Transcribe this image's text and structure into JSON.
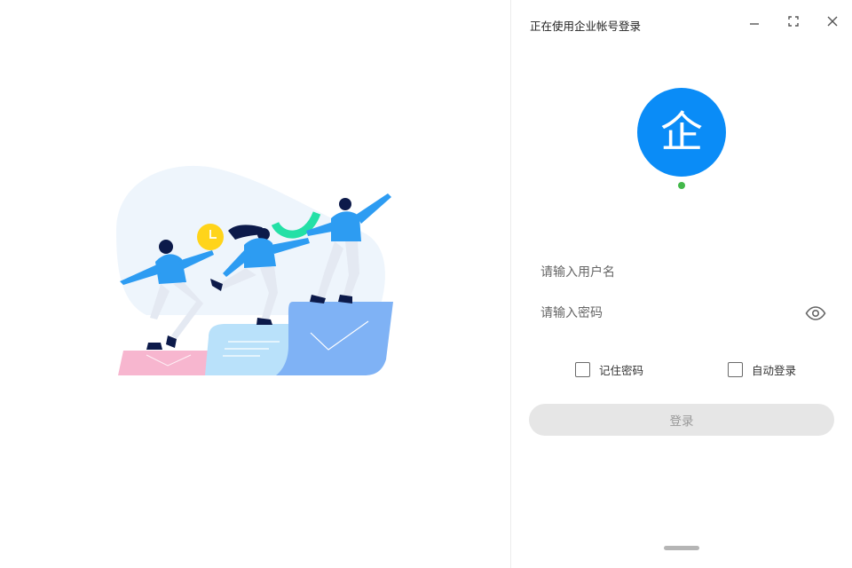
{
  "window": {
    "title": "正在使用企业帐号登录",
    "controls": {
      "minimize_icon": "minimize-icon",
      "maximize_icon": "maximize-icon",
      "close_icon": "close-icon"
    }
  },
  "illustration": {
    "icon": "team-running-illustration"
  },
  "avatar": {
    "char": "企",
    "bg_color": "#0a8cf7",
    "status": "online",
    "status_color": "#43b84a"
  },
  "form": {
    "username": {
      "value": "",
      "placeholder": "请输入用户名"
    },
    "password": {
      "value": "",
      "placeholder": "请输入密码",
      "toggle_icon": "eye-icon"
    },
    "remember_password": {
      "label": "记住密码",
      "checked": false
    },
    "auto_login": {
      "label": "自动登录",
      "checked": false
    },
    "login_button": {
      "label": "登录",
      "enabled": false
    }
  },
  "colors": {
    "accent": "#0a8cf7",
    "button_disabled_bg": "#e6e6e6",
    "button_disabled_text": "#9a9a9a"
  }
}
